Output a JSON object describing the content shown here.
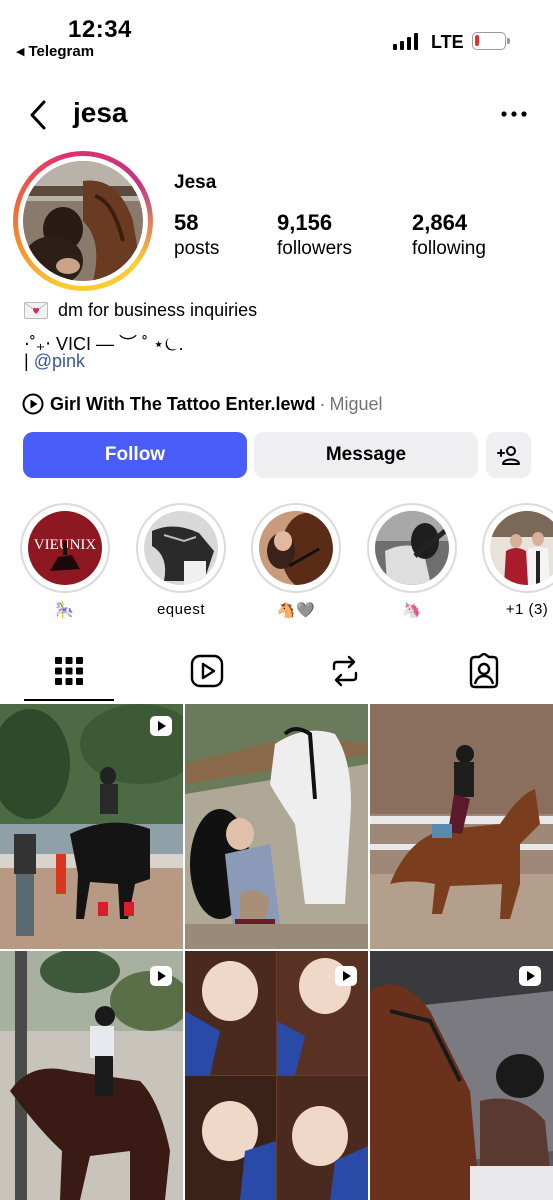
{
  "status_bar": {
    "time": "12:34",
    "back_app": "Telegram",
    "network": "LTE",
    "battery_color": "#e8302a"
  },
  "header": {
    "username": "jesa",
    "back_icon": "chevron-left-icon",
    "more_icon": "more-horizontal-icon"
  },
  "profile": {
    "display_name": "Jesa",
    "stats": [
      {
        "value": "58",
        "label": "posts"
      },
      {
        "value": "9,156",
        "label": "followers"
      },
      {
        "value": "2,864",
        "label": "following"
      }
    ],
    "bio_line1": "dm for business inquiries",
    "bio_line2": "⋅˚₊‧ VICI — ︶ ˚ ⋆⏾.",
    "bio_line3_prefix": "| ",
    "bio_link": "@pink"
  },
  "music": {
    "song": "Girl With The Tattoo Enter.lewd",
    "separator": "·",
    "artist": "Miguel"
  },
  "buttons": {
    "follow": "Follow",
    "message": "Message",
    "follow_color": "#4a5df9"
  },
  "highlights": [
    {
      "caption": "🎠"
    },
    {
      "caption": "equest"
    },
    {
      "caption": "🐴🩶"
    },
    {
      "caption": "🦄"
    },
    {
      "caption": "+1 (3)"
    }
  ],
  "highlight_text": {
    "vieunix": "VIEUNIX"
  },
  "tabs": [
    "grid-icon",
    "reels-icon",
    "reposts-icon",
    "tagged-icon"
  ]
}
